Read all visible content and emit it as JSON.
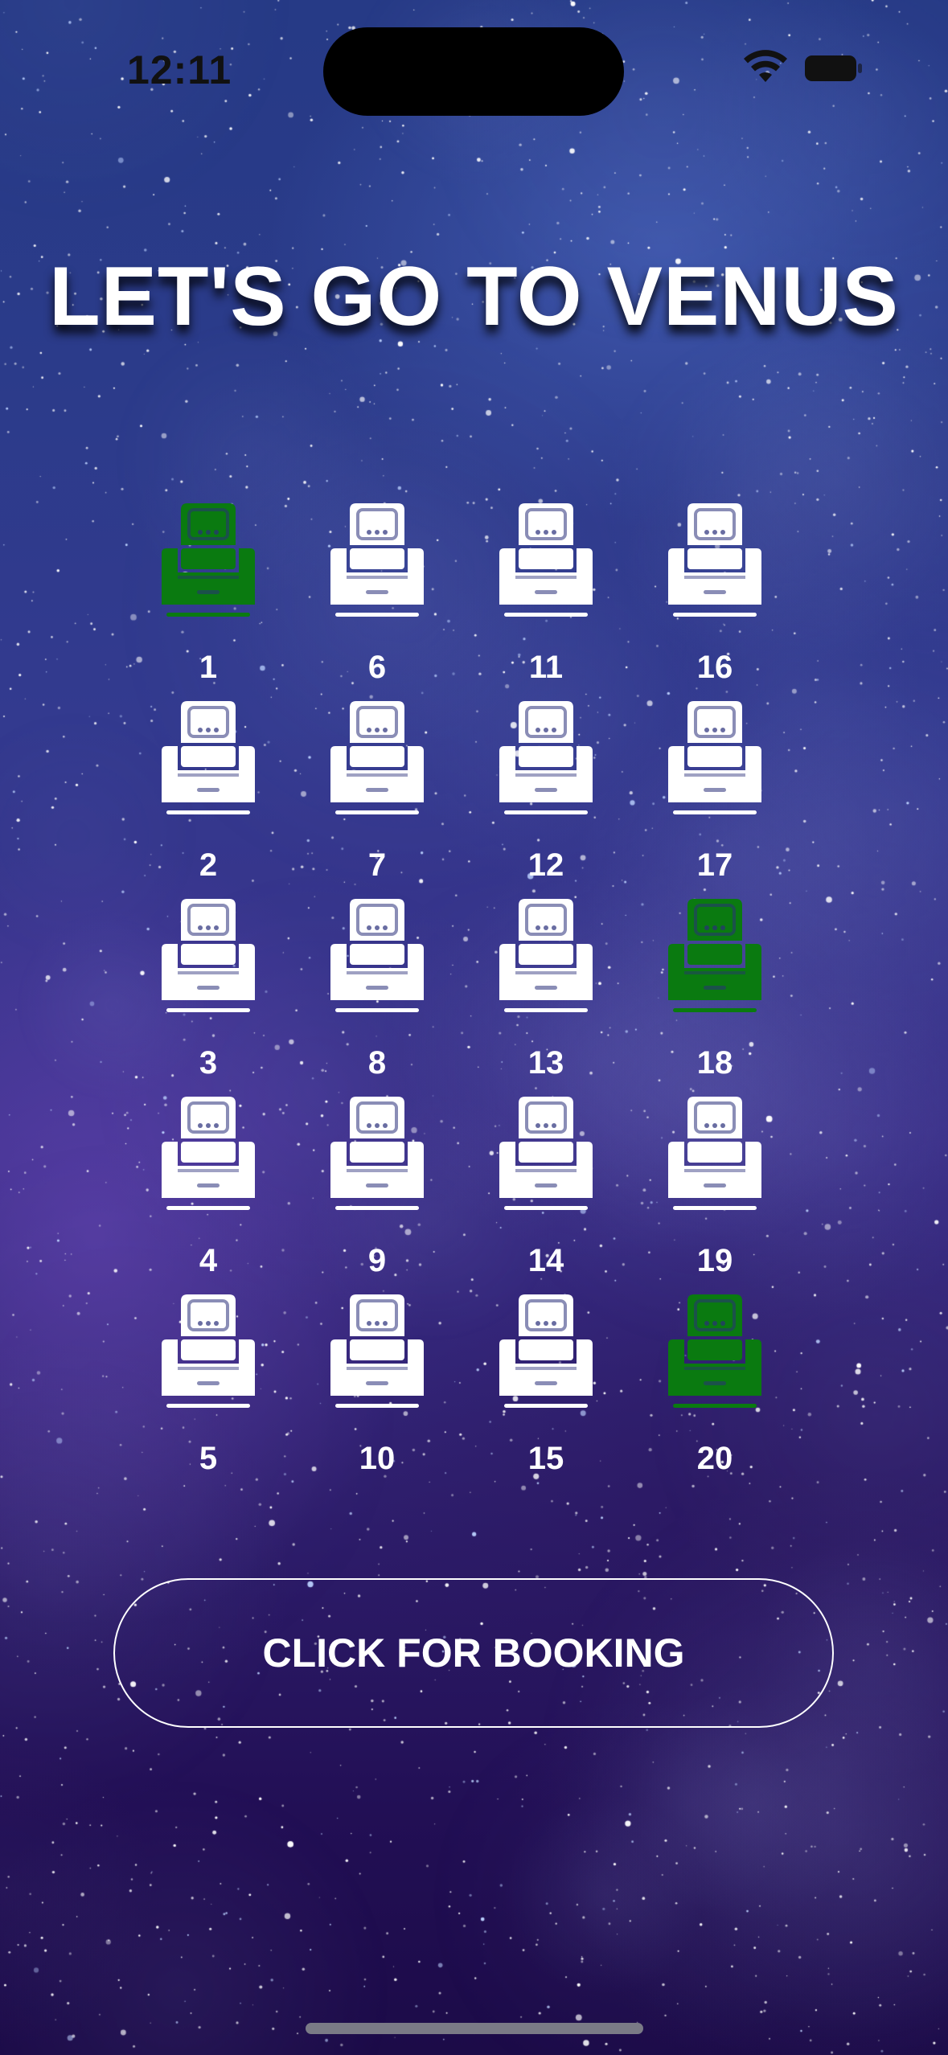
{
  "status_bar": {
    "time": "12:11"
  },
  "title": "LET'S GO TO VENUS",
  "colors": {
    "available_seat": "#ffffff",
    "selected_seat": "#0a7a10",
    "button_border": "#ffffff"
  },
  "seat_icon": "seat-icon",
  "seat_columns": [
    [
      {
        "number": "1",
        "selected": true
      },
      {
        "number": "2",
        "selected": false
      },
      {
        "number": "3",
        "selected": false
      },
      {
        "number": "4",
        "selected": false
      },
      {
        "number": "5",
        "selected": false
      }
    ],
    [
      {
        "number": "6",
        "selected": false
      },
      {
        "number": "7",
        "selected": false
      },
      {
        "number": "8",
        "selected": false
      },
      {
        "number": "9",
        "selected": false
      },
      {
        "number": "10",
        "selected": false
      }
    ],
    [
      {
        "number": "11",
        "selected": false
      },
      {
        "number": "12",
        "selected": false
      },
      {
        "number": "13",
        "selected": false
      },
      {
        "number": "14",
        "selected": false
      },
      {
        "number": "15",
        "selected": false
      }
    ],
    [
      {
        "number": "16",
        "selected": false
      },
      {
        "number": "17",
        "selected": false
      },
      {
        "number": "18",
        "selected": true
      },
      {
        "number": "19",
        "selected": false
      },
      {
        "number": "20",
        "selected": true
      }
    ]
  ],
  "booking_button": {
    "label": "CLICK FOR BOOKING"
  }
}
